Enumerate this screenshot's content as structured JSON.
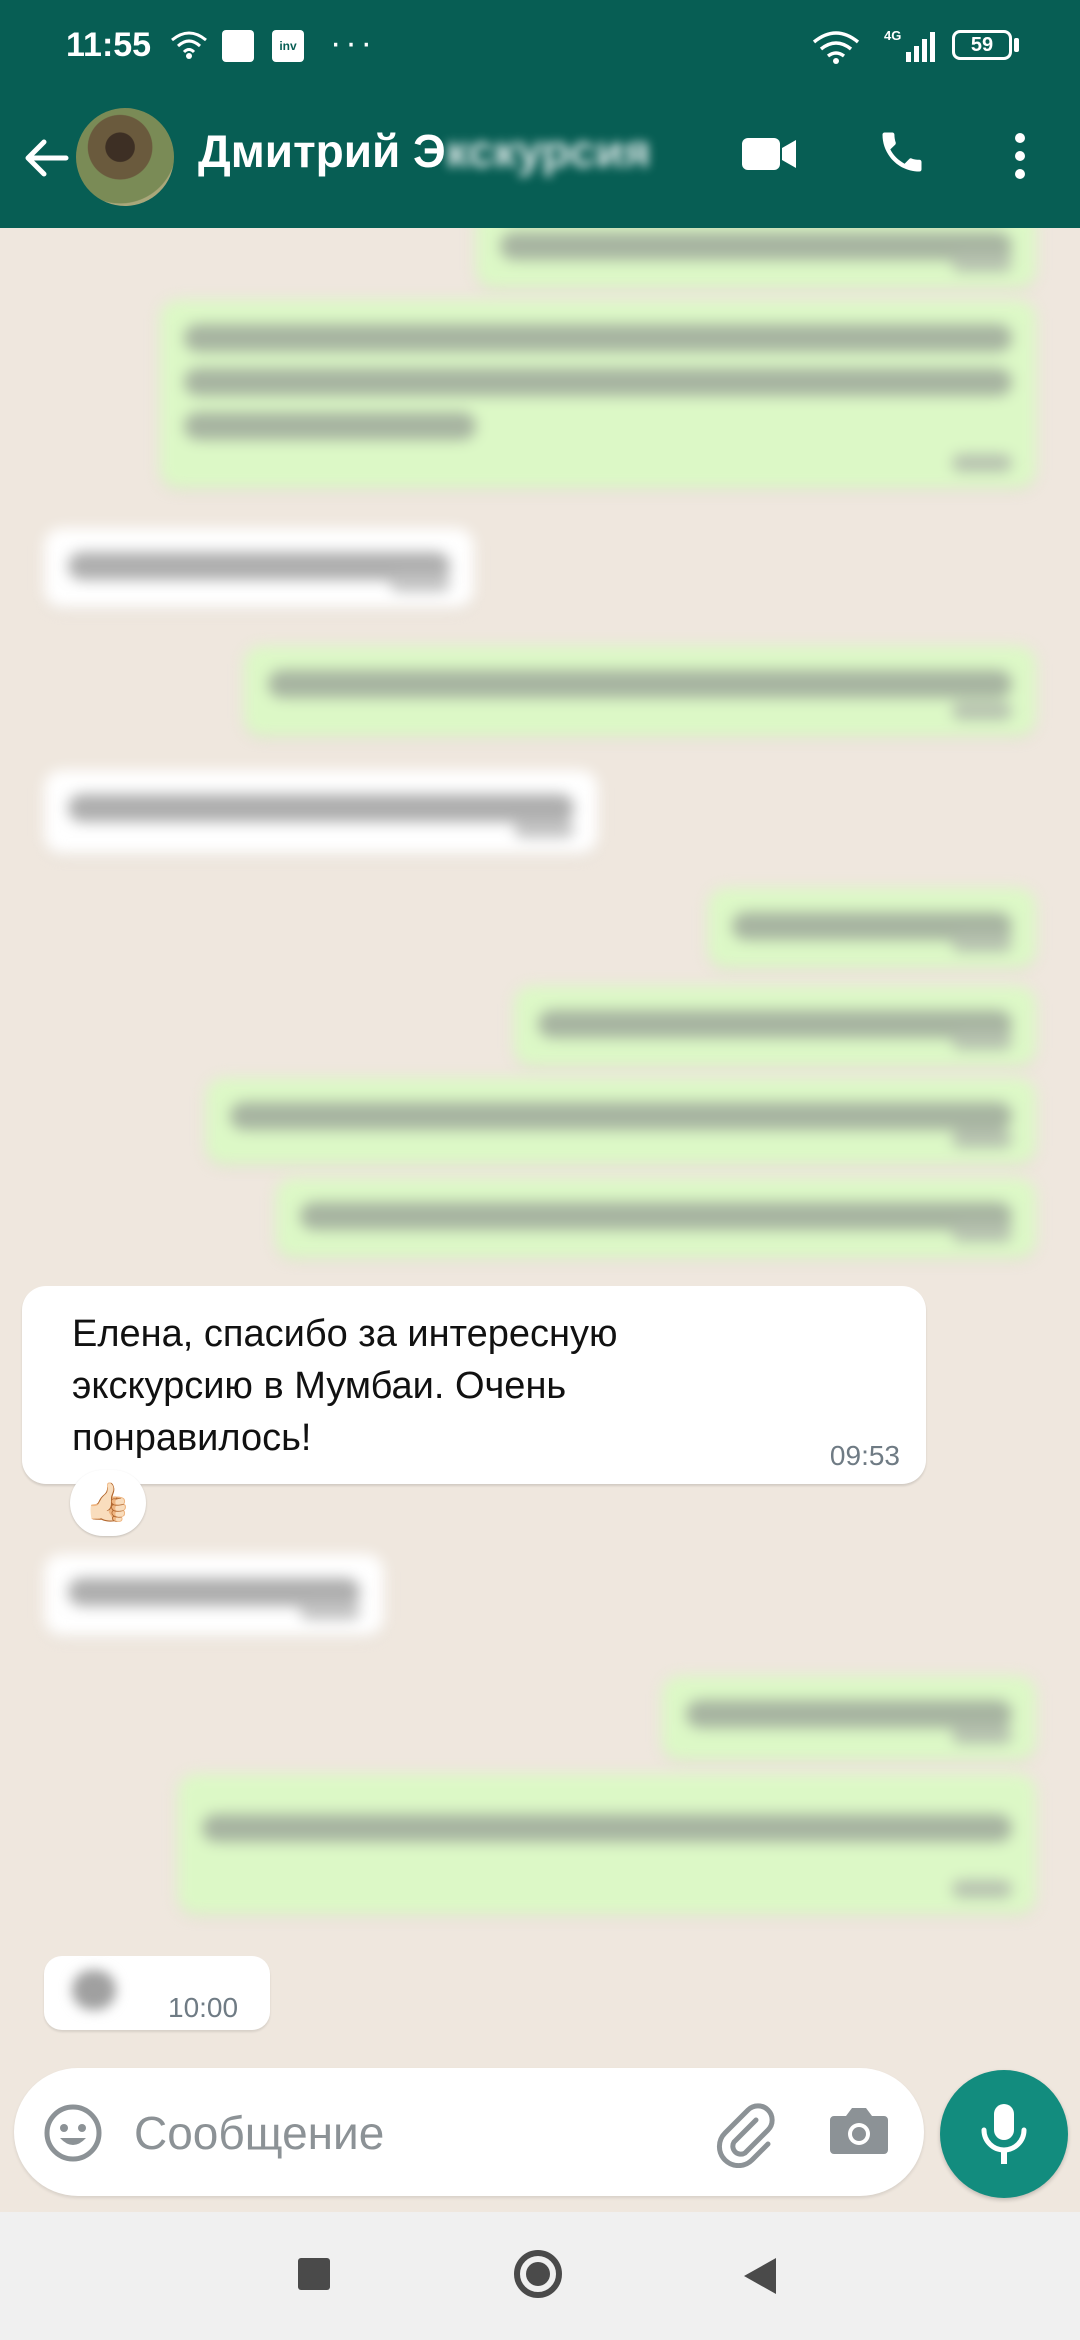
{
  "status_bar": {
    "time": "11:55",
    "inv_label": "inv",
    "dots": "···",
    "network": "4G",
    "battery": "59"
  },
  "header": {
    "contact_name": "Дмитрий Э",
    "contact_name_blurred": "кскурсия"
  },
  "messages": {
    "highlight": {
      "text": "Елена, спасибо за интересную экскурсию в Мумбаи. Очень понравилось!",
      "time": "09:53",
      "reaction": "👍🏻"
    },
    "last_time": "10:00"
  },
  "input": {
    "placeholder": "Сообщение"
  },
  "icons": {
    "back": "arrow-left-icon",
    "video": "video-camera-icon",
    "call": "phone-icon",
    "menu": "more-vert-icon",
    "emoji": "emoji-icon",
    "attach": "paperclip-icon",
    "camera": "camera-icon",
    "mic": "mic-icon"
  },
  "colors": {
    "header": "#075e54",
    "outgoing_bubble": "#dcf8c6",
    "incoming_bubble": "#ffffff",
    "mic_button": "#128c7e",
    "chat_background": "#efe7de"
  }
}
